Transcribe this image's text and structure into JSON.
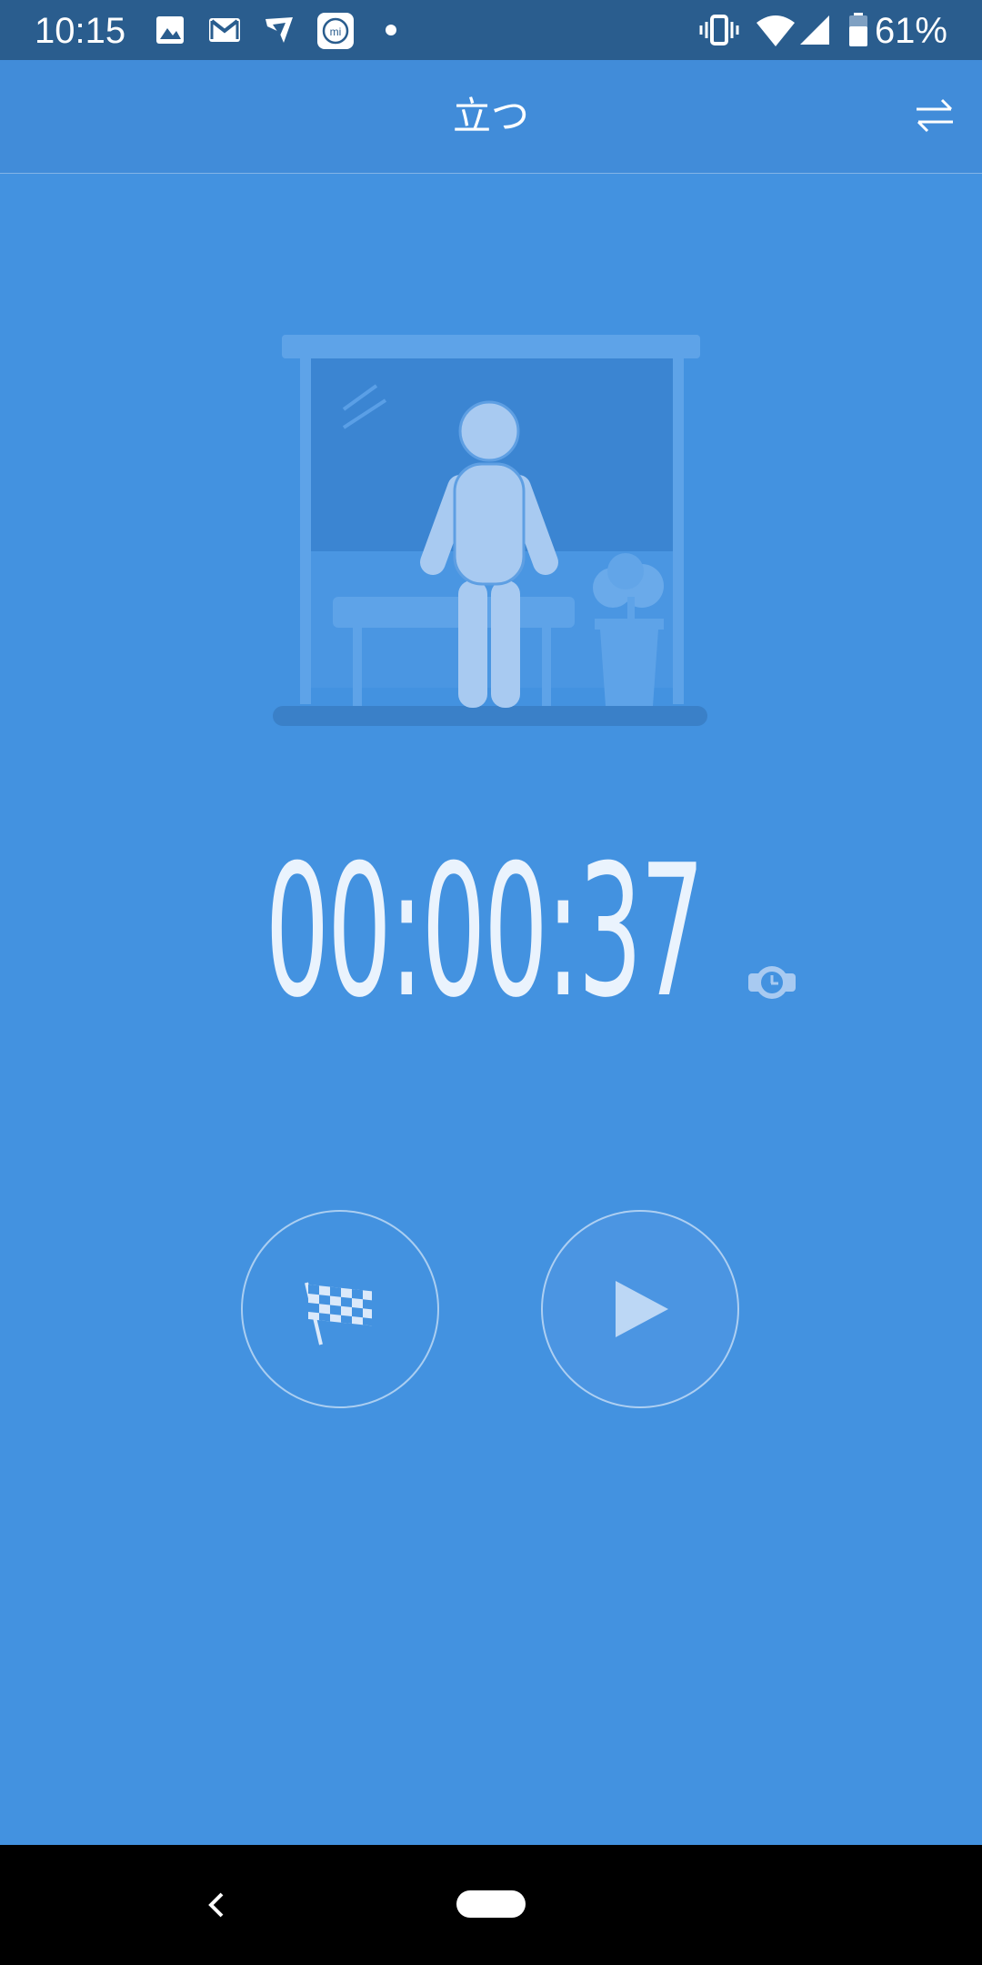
{
  "status_bar": {
    "time": "10:15",
    "battery_percent": "61%",
    "icons": [
      "image-icon",
      "gmail-icon",
      "app-notification-icon",
      "mi-fit-icon",
      "dot-icon",
      "vibrate-icon",
      "wifi-icon",
      "signal-icon",
      "battery-icon"
    ]
  },
  "header": {
    "title": "立つ",
    "swap_icon": "swap-arrows-icon"
  },
  "timer": {
    "value": "00:00:37",
    "icon": "watch-clock-icon"
  },
  "controls": {
    "lap_icon": "checkered-flag-icon",
    "play_icon": "play-icon"
  },
  "colors": {
    "background": "#4392e0",
    "status_bar": "#2a5d8e",
    "illustration": "#a8caf1"
  }
}
